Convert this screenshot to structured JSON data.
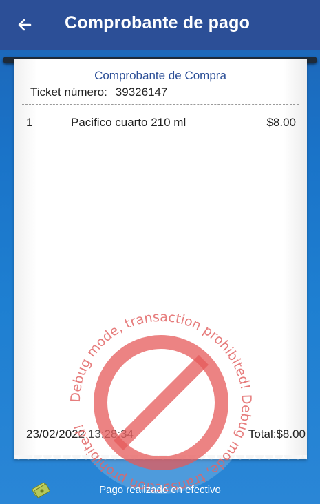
{
  "appbar": {
    "title": "Comprobante de pago",
    "back_icon": "arrow-left-icon"
  },
  "receipt": {
    "title": "Comprobante de Compra",
    "ticket_label": "Ticket número:",
    "ticket_number": "39326147",
    "items": [
      {
        "qty": "1",
        "name": "Pacifico cuarto 210 ml",
        "price": "$8.00"
      }
    ],
    "date": "23/02/2022 13:28:34",
    "total": "Total:$8.00"
  },
  "watermark": {
    "text": "Debug mode, transaction prohibited! Debug mode, transaction prohibited! ",
    "color": "#e63b3b"
  },
  "footer": {
    "payment_text": "Pago realizado en efectivo",
    "icon": "cash-icon"
  },
  "colors": {
    "appbar": "#2c4f97",
    "accent_text": "#2c4f97",
    "background": "#1a73c8"
  }
}
